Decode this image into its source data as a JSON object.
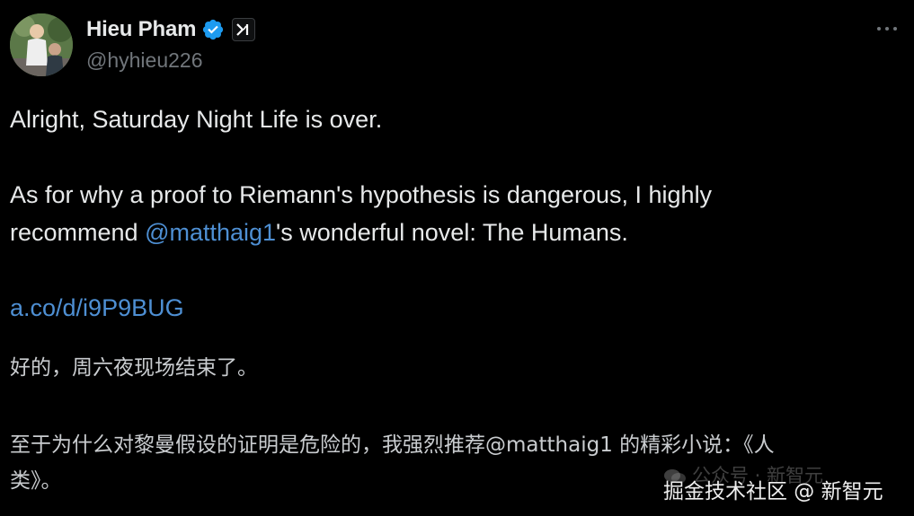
{
  "author": {
    "display_name": "Hieu Pham",
    "handle": "@hyhieu226",
    "affiliate_badge": "x",
    "verified_color": "#1d9bf0"
  },
  "tweet": {
    "line1": "Alright, Saturday Night Life is over.",
    "line2": "As for why a proof to Riemann's hypothesis is dangerous, I highly",
    "line3_prefix": "recommend ",
    "line3_mention": "@matthaig1",
    "line3_suffix": "'s wonderful novel: The Humans.",
    "link": "a.co/d/i9P9BUG"
  },
  "translation": {
    "line1": "好的，周六夜现场结束了。",
    "line2": "至于为什么对黎曼假设的证明是危险的，我强烈推荐@matthaig1 的精彩小说：《人",
    "line3": "类》。"
  },
  "watermark": {
    "top": "公众号 · 新智元",
    "bottom": "掘金技术社区 @ 新智元"
  },
  "colors": {
    "background": "#000000",
    "text": "#e7e9ea",
    "secondary": "#71767b",
    "link": "#4e8fd3"
  },
  "icons": {
    "verified": "verified-badge-icon",
    "more": "more-options-icon",
    "affiliate": "affiliate-badge-icon"
  }
}
